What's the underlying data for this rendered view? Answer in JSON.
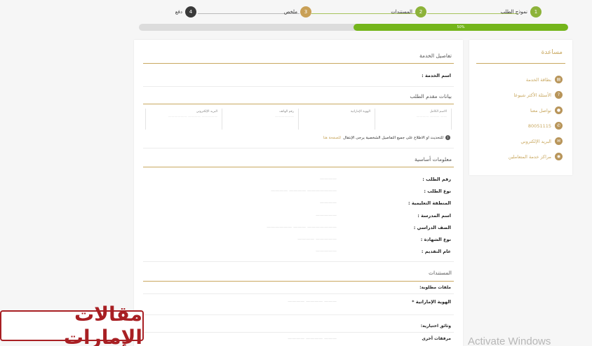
{
  "stepper": {
    "steps": [
      {
        "num": "1",
        "label": "نموذج الطلب",
        "color": "#8db33a"
      },
      {
        "num": "2",
        "label": "المستندات",
        "color": "#8db33a"
      },
      {
        "num": "3",
        "label": "ملخص",
        "color": "#c9a056"
      },
      {
        "num": "4",
        "label": "دفع",
        "color": "#3a3a3a"
      }
    ]
  },
  "progress": {
    "percent_label": "50%",
    "fraction": 0.5
  },
  "main": {
    "service_details": {
      "title": "تفاصيل الخدمة",
      "service_name_label": "اسم الخدمة :"
    },
    "applicant": {
      "title": "بيانات مقدم الطلب",
      "columns": [
        {
          "key": "الاسم الكامل",
          "value": "—— ——— ————"
        },
        {
          "key": "الهوية الإماراتية",
          "value": ""
        },
        {
          "key": "رقم الهاتف",
          "value": "——————"
        },
        {
          "key": "البريد الإلكتروني",
          "value": "————— ———— ——————"
        }
      ],
      "notice_text": "للتحديث او الاطلاع على جميع التفاصيل الشخصية يرجى الإنتقال",
      "notice_link": "للصفحة هنا"
    },
    "basic_info": {
      "title": "معلومات أساسية",
      "fields": [
        {
          "label": "رقم الطلب :",
          "value": "————"
        },
        {
          "label": "نوع الطلب :",
          "value": "——————— ———— ————"
        },
        {
          "label": "المنطقة التعليمية :",
          "value": "————"
        },
        {
          "label": "اسم المدرسة :",
          "value": "—————"
        },
        {
          "label": "الصف الدراسي :",
          "value": "——————— ——— ——————"
        },
        {
          "label": "نوع الشهادة :",
          "value": "————— ————"
        },
        {
          "label": "عام التقديم :",
          "value": "—————"
        }
      ]
    },
    "documents": {
      "title": "المستندات",
      "required_label": "ملفات مطلوبة:",
      "emirates_id_label": "الهوية الإماراتية *",
      "emirates_id_value": "——— ———— ————",
      "optional_label": "وثائق اختيارية:",
      "other_label": "مرفقات أخرى",
      "other_value": "——— ———— ————"
    }
  },
  "help": {
    "title": "مساعدة",
    "items": [
      {
        "label": "بطاقة الخدمة",
        "icon": "document-icon",
        "glyph": "▤"
      },
      {
        "label": "الأسئلة الأكثر شيوعا",
        "icon": "question-icon",
        "glyph": "?"
      },
      {
        "label": "تواصل معنا",
        "icon": "location-icon",
        "glyph": "●"
      },
      {
        "label": "80051115",
        "icon": "phone-icon",
        "glyph": "✆"
      },
      {
        "label": "البريد الإلكتروني",
        "icon": "mail-icon",
        "glyph": "✉"
      },
      {
        "label": "مراكز خدمة المتعاملين",
        "icon": "service-center-icon",
        "glyph": "◉"
      }
    ]
  },
  "watermark": {
    "logo_text": "مقالات الإمارات"
  },
  "os_overlay": {
    "activate_text": "Activate Windows"
  },
  "colors": {
    "gold": "#c9a860",
    "green": "#74b51b",
    "logo_red": "#a81f23"
  }
}
